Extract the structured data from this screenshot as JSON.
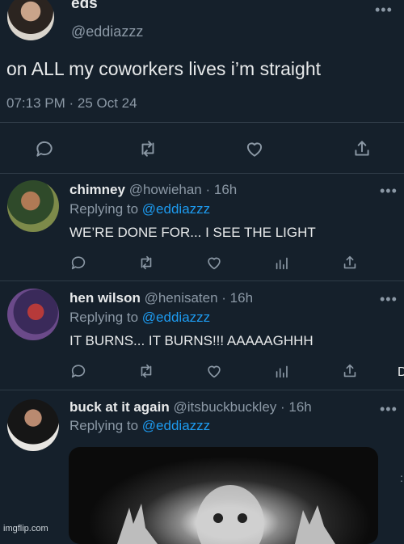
{
  "main_tweet": {
    "display_name": "eds",
    "handle": "@eddiazzz",
    "text": "on ALL my coworkers lives i’m straight",
    "timestamp": "07:13 PM · 25 Oct 24",
    "more_glyph": "•••",
    "actions": [
      "reply-icon",
      "retweet-icon",
      "like-icon",
      "share-icon"
    ]
  },
  "replies": [
    {
      "display_name": "chimney",
      "meta": "@howiehan · 16h",
      "replying_prefix": "Replying to",
      "replying_handle": "@eddiazzz",
      "text": "WE’RE DONE FOR... I SEE THE LIGHT",
      "more_glyph": "•••"
    },
    {
      "display_name": "hen wilson",
      "meta": "@henisaten · 16h",
      "replying_prefix": "Replying to",
      "replying_handle": "@eddiazzz",
      "text": "IT BURNS... IT BURNS!!! AAAAAGHHH",
      "more_glyph": "•••"
    },
    {
      "display_name": "buck at it again",
      "meta": "@itsbuckbuckley · 16h",
      "replying_prefix": "Replying to",
      "replying_handle": "@eddiazzz",
      "more_glyph": "•••"
    }
  ],
  "watermark": "imgflip.com",
  "edge_char": "D",
  "colors": {
    "background": "#15202b",
    "muted": "#8b98a5",
    "link": "#1d9bf0",
    "text": "#e7e9ea"
  }
}
